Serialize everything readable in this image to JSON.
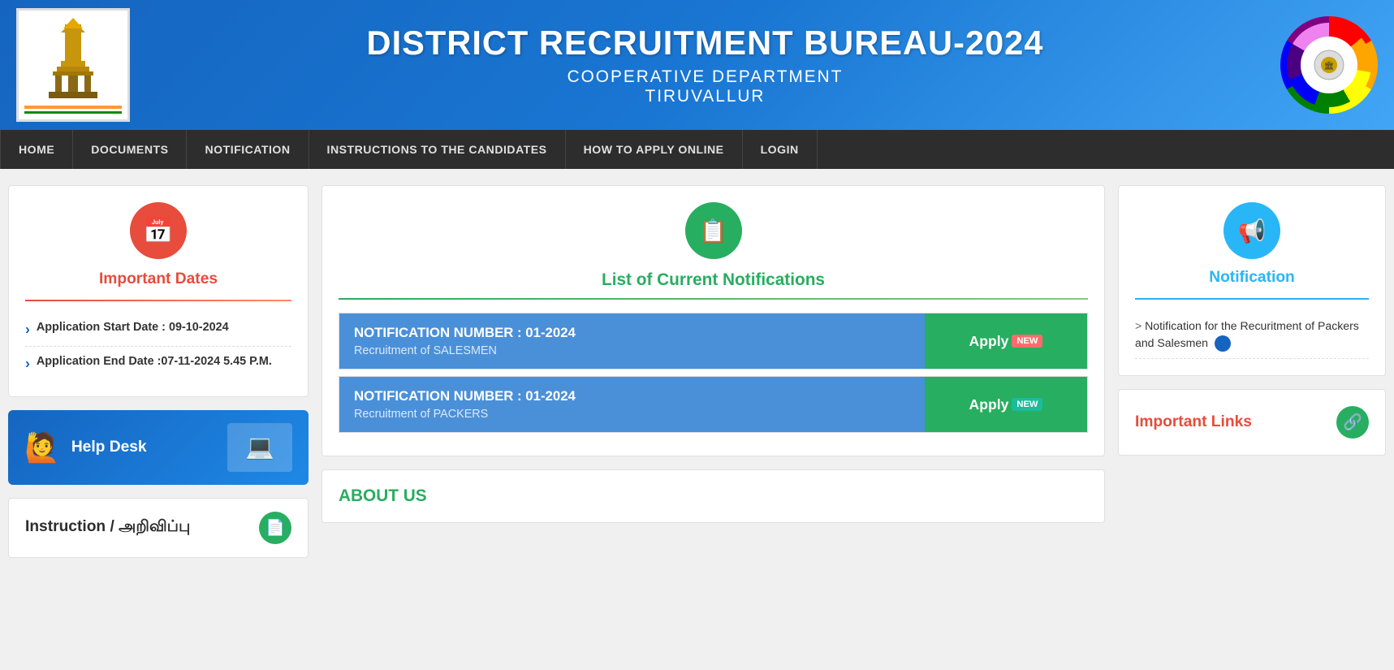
{
  "header": {
    "title": "DISTRICT RECRUITMENT BUREAU-2024",
    "subtitle1": "COOPERATIVE DEPARTMENT",
    "subtitle2": "TIRUVALLUR"
  },
  "nav": {
    "items": [
      {
        "label": "HOME",
        "href": "#"
      },
      {
        "label": "DOCUMENTS",
        "href": "#"
      },
      {
        "label": "NOTIFICATION",
        "href": "#"
      },
      {
        "label": "INSTRUCTIONS TO THE CANDIDATES",
        "href": "#"
      },
      {
        "label": "HOW TO APPLY ONLINE",
        "href": "#"
      },
      {
        "label": "LOGIN",
        "href": "#"
      }
    ]
  },
  "sidebar_left": {
    "important_dates": {
      "title": "Important Dates",
      "items": [
        {
          "text": "Application Start Date : 09-10-2024"
        },
        {
          "text": "Application End Date :07-11-2024 5.45 P.M."
        }
      ]
    },
    "helpdesk": {
      "label": "Help Desk"
    },
    "instruction": {
      "title": "Instruction / அறிவிப்பு"
    }
  },
  "center": {
    "notifications_title": "List of Current Notifications",
    "notifications": [
      {
        "number": "NOTIFICATION NUMBER : 01-2024",
        "description": "Recruitment of SALESMEN",
        "apply_label": "Apply",
        "badge": "NEW"
      },
      {
        "number": "NOTIFICATION NUMBER : 01-2024",
        "description": "Recruitment of PACKERS",
        "apply_label": "Apply",
        "badge": "NEW"
      }
    ],
    "about_title": "ABOUT US"
  },
  "sidebar_right": {
    "notification_title": "Notification",
    "notification_items": [
      "Notification for the Recuritment of Packers and Salesmen"
    ],
    "important_links_title": "Important Links"
  }
}
